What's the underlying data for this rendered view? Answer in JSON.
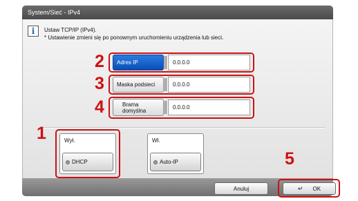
{
  "window": {
    "title": "System/Sieć - IPv4"
  },
  "info": {
    "line1": "Ustaw TCP/IP (IPv4).",
    "line2": "* Ustawienie zmieni się po ponownym uruchomieniu urządzenia lub sieci."
  },
  "icons": {
    "info": "i",
    "enter": "↵"
  },
  "fields": [
    {
      "label": "Adres IP",
      "value": "0.0.0.0",
      "active": true
    },
    {
      "label": "Maska podsieci",
      "value": "0.0.0.0",
      "active": false
    },
    {
      "label_line1": "Brama",
      "label_line2": "domyślna",
      "value": "0.0.0.0",
      "active": false
    }
  ],
  "dhcp_group": {
    "title": "Wył.",
    "button": "DHCP"
  },
  "autoip_group": {
    "title": "Wł.",
    "button": "Auto-IP"
  },
  "footer": {
    "cancel": "Anuluj",
    "ok": "OK"
  },
  "callouts": {
    "one": "1",
    "two": "2",
    "three": "3",
    "four": "4",
    "five": "5"
  },
  "colors": {
    "accent_active": "#0a4fb8",
    "callout_red": "#cc1111"
  }
}
